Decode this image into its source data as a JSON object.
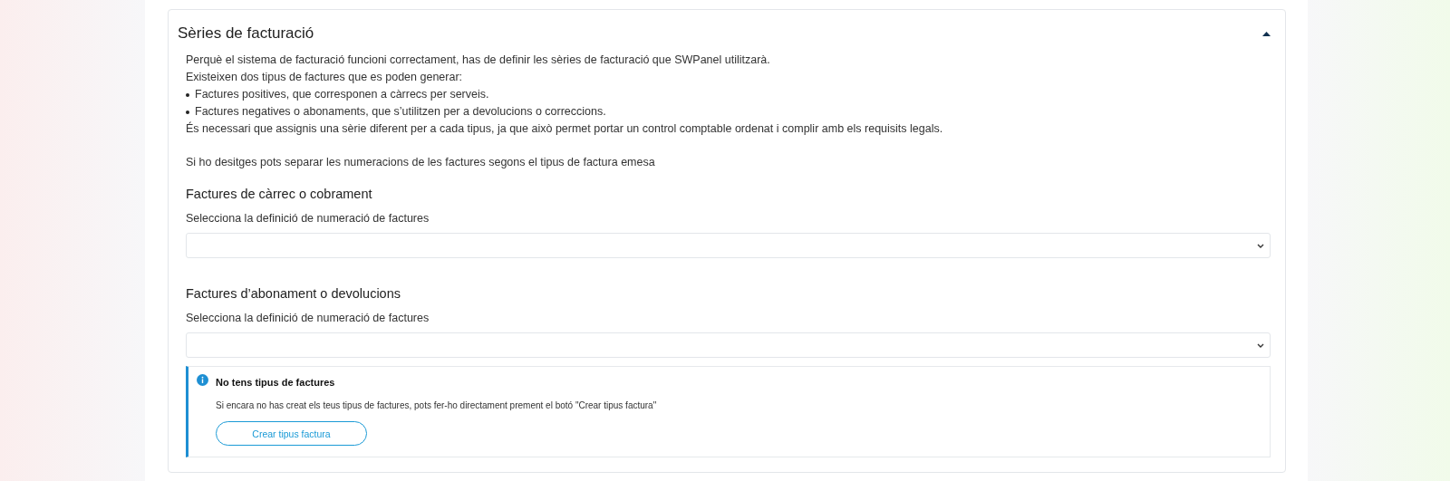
{
  "section": {
    "title": "Sèries de facturació",
    "expanded": true,
    "intro": [
      "Perquè el sistema de facturació funcioni correctament, has de definir les sèries de facturació que SWPanel utilitzarà.",
      "Existeixen dos tipus de factures que es poden generar:"
    ],
    "bullets": [
      "Factures positives, que corresponen a càrrecs per serveis.",
      "Factures negatives o abonaments, que s’utilitzen per a devolucions o correccions."
    ],
    "note": "És necessari que assignis una sèrie diferent per a cada tipus, ja que això permet portar un control comptable ordenat i complir amb els requisits legals.",
    "hint": "Si ho desitges pots separar les numeracions de les factures segons el tipus de factura emesa",
    "groups": [
      {
        "heading": "Factures de càrrec o cobrament",
        "label": "Selecciona la definició de numeració de factures"
      },
      {
        "heading": "Factures d’abonament o devolucions",
        "label": "Selecciona la definició de numeració de factures"
      }
    ],
    "alert": {
      "title": "No tens tipus de factures",
      "text": "Si encara no has creat els teus tipus de factures, pots fer-ho directament prement el botó \"Crear tipus factura\"",
      "button": "Crear tipus factura"
    }
  }
}
